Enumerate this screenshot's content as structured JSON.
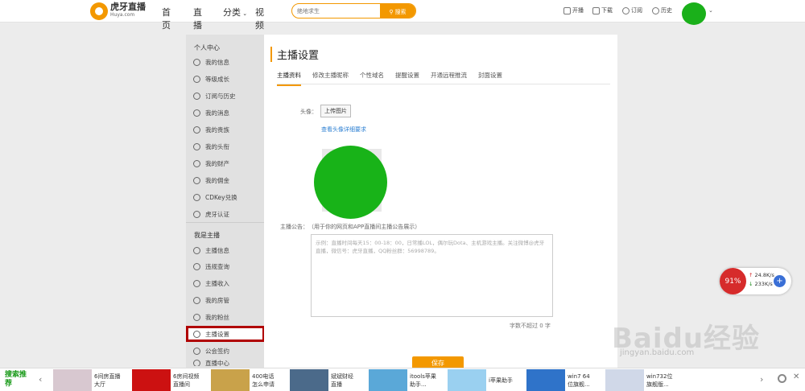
{
  "topbar": {
    "logo_main": "虎牙直播",
    "logo_sub": "Huya.com",
    "nav": [
      "首页",
      "直播",
      "分类",
      "视频"
    ],
    "search_placeholder": "绝地求生",
    "search_button": "搜索",
    "actions": [
      "开播",
      "下载",
      "订阅",
      "历史"
    ]
  },
  "sidebar": {
    "section1_title": "个人中心",
    "section1_items": [
      "我的信息",
      "等级成长",
      "订阅与历史",
      "我的消息",
      "我的贵族",
      "我的头衔",
      "我的财产",
      "我的佣金",
      "CDKey兑换",
      "虎牙认证"
    ],
    "section2_title": "我是主播",
    "section2_items": [
      "主播信息",
      "违规查询",
      "主播收入",
      "我的房管",
      "我的粉丝",
      "主播设置",
      "公会签约",
      "直播中心"
    ]
  },
  "content": {
    "title": "主播设置",
    "tabs": [
      "主播资料",
      "修改主播昵称",
      "个性域名",
      "提醒设置",
      "开通远程推流",
      "封面设置"
    ],
    "avatar_label": "头像：",
    "upload_button": "上传图片",
    "avatar_link": "查看头像详细要求",
    "notice_label": "主播公告：",
    "notice_hint": "（用于你的网页和APP直播间主播公告展示）",
    "notice_placeholder": "示例：直播时间每天15：00-18：00，日常播LOL，偶尔玩Dota、主机游戏主播。关注微博@虎牙直播，微信号：虎牙直播，QQ粉丝群：56998789。",
    "count_text": "字数不超过 0 字",
    "save_button": "保存"
  },
  "netmonitor": {
    "percent": "91%",
    "up": "24.8K/s",
    "down": "233K/s",
    "plus": "+"
  },
  "watermark": {
    "text": "Baidu经验",
    "sub": "jingyan.baidu.com"
  },
  "adbar": {
    "title": "搜索推荐",
    "items": [
      {
        "text": "6间房直播大厅",
        "color": "#d8c8d0"
      },
      {
        "text": "6房间视频直播间",
        "color": "#cc1111"
      },
      {
        "text": "400电话怎么申请",
        "color": "#c9a24a"
      },
      {
        "text": "斌斌财经直播",
        "color": "#4b6a8a"
      },
      {
        "text": "itools苹果助手...",
        "color": "#5aa8d8"
      },
      {
        "text": "i苹果助手",
        "color": "#9ad0f0"
      },
      {
        "text": "win7 64位旗舰...",
        "color": "#2f73c9"
      },
      {
        "text": "win732位旗舰版...",
        "color": "#d0d8e8"
      }
    ]
  }
}
